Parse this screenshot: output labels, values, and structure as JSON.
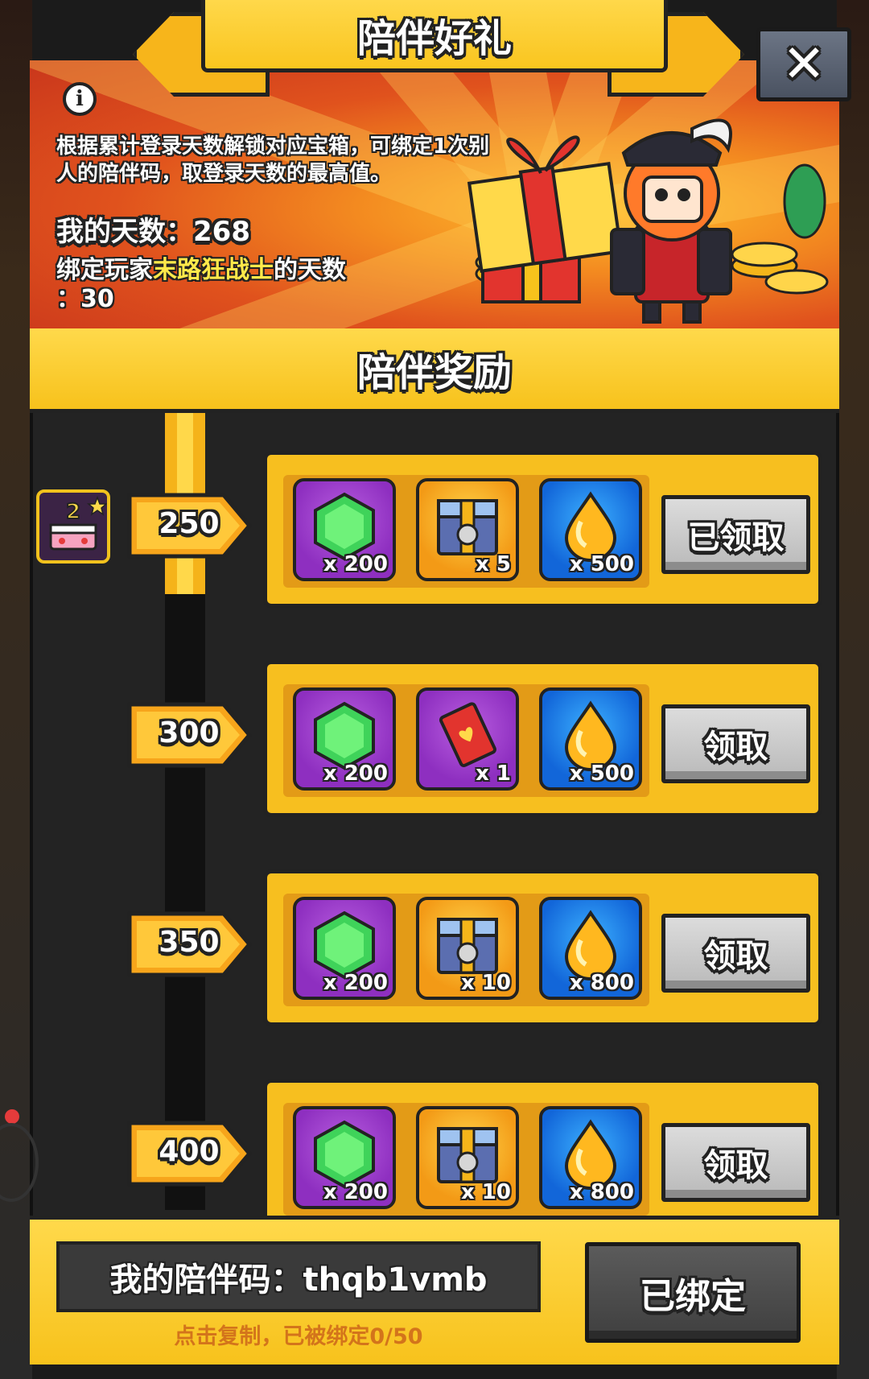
{
  "title": "陪伴好礼",
  "close_glyph": "✕",
  "info_glyph": "i",
  "description": "根据累计登录天数解锁对应宝箱，可绑定1次别人的陪伴码，取登录天数的最高值。",
  "my_days": {
    "label": "我的天数：",
    "value": "268"
  },
  "bound_player": {
    "prefix": "绑定玩家",
    "name": "末路狂战士",
    "suffix": "的天数",
    "colon_value": "：30"
  },
  "section_title": "陪伴奖励",
  "badge": {
    "level": "2"
  },
  "milestones": [
    {
      "days": "250",
      "items": [
        {
          "icon": "green-gem-icon",
          "qty": "x 200"
        },
        {
          "icon": "treasure-chest-icon",
          "qty": "x 5"
        },
        {
          "icon": "gold-droplet-icon",
          "qty": "x 500"
        }
      ],
      "button": "已领取"
    },
    {
      "days": "300",
      "items": [
        {
          "icon": "green-gem-icon",
          "qty": "x 200"
        },
        {
          "icon": "red-card-icon",
          "qty": "x 1"
        },
        {
          "icon": "gold-droplet-icon",
          "qty": "x 500"
        }
      ],
      "button": "领取"
    },
    {
      "days": "350",
      "items": [
        {
          "icon": "green-gem-icon",
          "qty": "x 200"
        },
        {
          "icon": "treasure-chest-icon",
          "qty": "x 10"
        },
        {
          "icon": "gold-droplet-icon",
          "qty": "x 800"
        }
      ],
      "button": "领取"
    },
    {
      "days": "400",
      "items": [
        {
          "icon": "green-gem-icon",
          "qty": "x 200"
        },
        {
          "icon": "treasure-chest-icon",
          "qty": "x 10"
        },
        {
          "icon": "gold-droplet-icon",
          "qty": "x 800"
        }
      ],
      "button": "领取"
    }
  ],
  "my_code": {
    "label": "我的陪伴码：",
    "value": "thqb1vmb"
  },
  "copy_hint": "点击复制，已被绑定0/50",
  "bound_button": "已绑定",
  "colors": {
    "panel_yellow": "#f7bf1f",
    "banner_orange": "#e0521d",
    "highlight_text": "#ffe94a",
    "hint_orange": "#d3741b",
    "button_grey": "#c8c8c8",
    "bound_button_dark": "#4a4a4a"
  }
}
